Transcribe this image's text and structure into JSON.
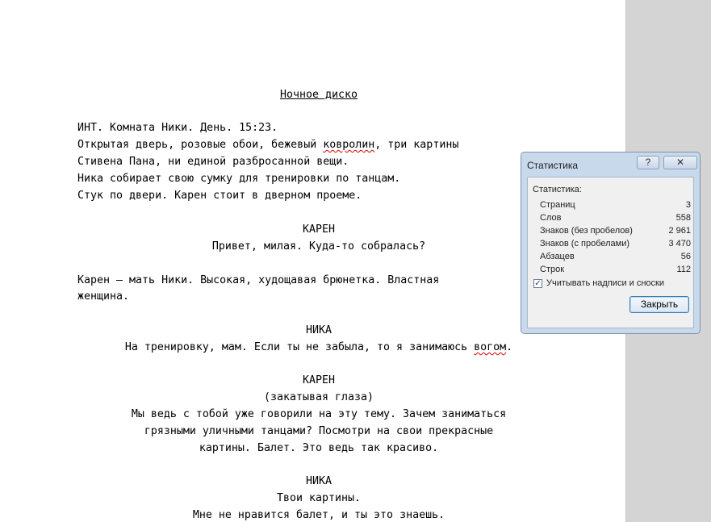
{
  "document": {
    "title": "Ночное диско",
    "lines": [
      [
        "ИНТ. Комната Ники. День. 15:23."
      ],
      [
        "Открытая дверь, розовые обои, бежевый ",
        "ковролин",
        ", три картины"
      ],
      [
        "Стивена Пана, ни единой разбросанной вещи."
      ],
      [
        "Ника собирает свою сумку для тренировки по танцам."
      ],
      [
        "Стук по двери. Карен стоит в дверном проеме."
      ],
      [
        "КАРЕН"
      ],
      [
        "Привет, милая. Куда-то собралась?"
      ],
      [
        "Карен – мать Ники. Высокая, худощавая брюнетка. Властная"
      ],
      [
        "женщина."
      ],
      [
        "НИКА"
      ],
      [
        "На тренировку, мам. Если ты не забыла, то я занимаюсь ",
        "вогом",
        "."
      ],
      [
        "КАРЕН"
      ],
      [
        "(закатывая глаза)"
      ],
      [
        "Мы ведь с тобой уже говорили на эту тему. Зачем заниматься"
      ],
      [
        "грязными уличными танцами? Посмотри на свои прекрасные"
      ],
      [
        "картины. Балет. Это ведь так красиво."
      ],
      [
        "НИКА"
      ],
      [
        "Твои картины."
      ],
      [
        "Мне не нравится балет, и ты это знаешь."
      ]
    ]
  },
  "dialog": {
    "title": "Статистика",
    "help_label": "?",
    "close_x_label": "✕",
    "stats_header": "Статистика:",
    "stats": [
      {
        "label": "Страниц",
        "value": "3"
      },
      {
        "label": "Слов",
        "value": "558"
      },
      {
        "label": "Знаков (без пробелов)",
        "value": "2 961"
      },
      {
        "label": "Знаков (с пробелами)",
        "value": "3 470"
      },
      {
        "label": "Абзацев",
        "value": "56"
      },
      {
        "label": "Строк",
        "value": "112"
      }
    ],
    "checkbox_label": "Учитывать надписи и сноски",
    "checkbox_checked": true,
    "close_button": "Закрыть"
  }
}
